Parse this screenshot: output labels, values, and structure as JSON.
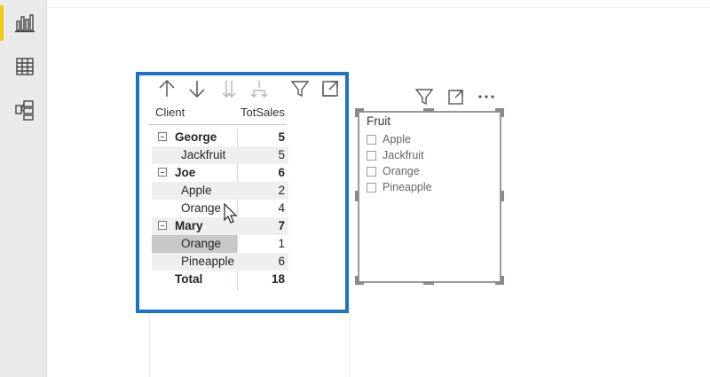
{
  "rail": {
    "icons": [
      "report-view-icon",
      "data-view-icon",
      "model-view-icon"
    ],
    "accent_color": "#f2c811"
  },
  "matrix": {
    "border_color": "#1b74c5",
    "toolbar_icons": [
      "drill-up-icon",
      "drill-down-icon",
      "expand-next-level-icon",
      "expand-all-icon",
      "filter-icon",
      "focus-mode-icon"
    ],
    "headers": {
      "client": "Client",
      "sales": "TotSales"
    },
    "rows": [
      {
        "type": "parent",
        "label": "George",
        "value": "5"
      },
      {
        "type": "child",
        "label": "Jackfruit",
        "value": "5"
      },
      {
        "type": "parent",
        "label": "Joe",
        "value": "6"
      },
      {
        "type": "child",
        "label": "Apple",
        "value": "2"
      },
      {
        "type": "child",
        "label": "Orange",
        "value": "4"
      },
      {
        "type": "parent",
        "label": "Mary",
        "value": "7"
      },
      {
        "type": "child",
        "label": "Orange",
        "value": "1",
        "selected": true
      },
      {
        "type": "child",
        "label": "Pineapple",
        "value": "6"
      },
      {
        "type": "total",
        "label": "Total",
        "value": "18"
      }
    ]
  },
  "slicer": {
    "toolbar_icons": [
      "filter-icon",
      "focus-mode-icon",
      "more-options-icon"
    ],
    "title": "Fruit",
    "items": [
      "Apple",
      "Jackfruit",
      "Orange",
      "Pineapple"
    ]
  }
}
